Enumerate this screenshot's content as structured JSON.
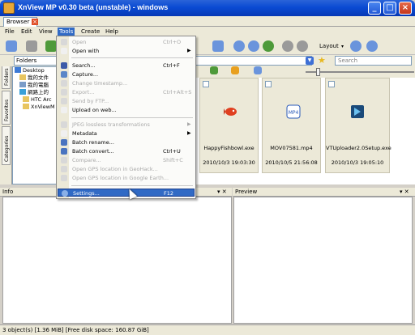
{
  "window": {
    "title": "XnView MP v0.30 beta (unstable) - windows",
    "controls": [
      "_",
      "□",
      "×"
    ]
  },
  "tab": {
    "label": "Browser",
    "close": "×"
  },
  "menubar": [
    "File",
    "Edit",
    "View",
    "Tools",
    "Create",
    "Help"
  ],
  "toolbar": {
    "layout_label": "Layout"
  },
  "address": {
    "folders_label": "Folders",
    "search_placeholder": "Search"
  },
  "left_tabs": [
    "Folders",
    "Favorites",
    "Categories"
  ],
  "tree": [
    "Desktop",
    "我的文件",
    "我的電腦",
    "網路上的",
    "HTC Arc",
    "XnViewM"
  ],
  "thumbnails": [
    {
      "name": "HappyFishbowl.exe",
      "date": "2010/10/3 19:03:30",
      "icon": "fish-icon"
    },
    {
      "name": "MOV07581.mp4",
      "date": "2010/10/5 21:56:08",
      "icon": "video-icon"
    },
    {
      "name": "VTUploader2.0Setup.exe",
      "date": "2010/10/3 19:05:10",
      "icon": "installer-icon"
    }
  ],
  "panels": {
    "info": "Info",
    "preview": "Preview",
    "ctl": "▾ ✕"
  },
  "status": "3 object(s) [1.36 MiB] [Free disk space: 160.87 GiB]",
  "tools_menu": [
    {
      "label": "Open",
      "shortcut": "Ctrl+O",
      "disabled": true,
      "icon": "folder-icon"
    },
    {
      "label": "Open with",
      "submenu": true,
      "disabled": false,
      "icon": "open-with-icon"
    },
    {
      "sep": true
    },
    {
      "label": "Search...",
      "shortcut": "Ctrl+F",
      "disabled": false,
      "icon": "binoculars-icon"
    },
    {
      "label": "Capture...",
      "disabled": false,
      "icon": "camera-icon"
    },
    {
      "label": "Change timestamp...",
      "disabled": true,
      "icon": "clock-icon"
    },
    {
      "label": "Export...",
      "shortcut": "Ctrl+Alt+S",
      "disabled": true,
      "icon": "export-icon"
    },
    {
      "label": "Send by FTP...",
      "disabled": true,
      "icon": "ftp-icon"
    },
    {
      "label": "Upload on web...",
      "disabled": false,
      "icon": "upload-icon"
    },
    {
      "sep": true
    },
    {
      "label": "JPEG lossless transformations",
      "submenu": true,
      "disabled": true,
      "icon": "jpeg-icon"
    },
    {
      "label": "Metadata",
      "submenu": true,
      "disabled": false,
      "icon": "metadata-icon"
    },
    {
      "label": "Batch rename...",
      "disabled": false,
      "icon": "rename-icon"
    },
    {
      "label": "Batch convert...",
      "shortcut": "Ctrl+U",
      "disabled": false,
      "icon": "convert-icon"
    },
    {
      "label": "Compare...",
      "shortcut": "Shift+C",
      "disabled": true,
      "icon": "compare-icon"
    },
    {
      "label": "Open GPS location in GeoHack...",
      "disabled": true,
      "icon": "gps-icon"
    },
    {
      "label": "Open GPS location in Google Earth...",
      "disabled": true,
      "icon": "earth-icon"
    },
    {
      "sep": true
    },
    {
      "label": "Settings...",
      "shortcut": "F12",
      "disabled": false,
      "highlighted": true,
      "icon": "gear-icon"
    }
  ]
}
